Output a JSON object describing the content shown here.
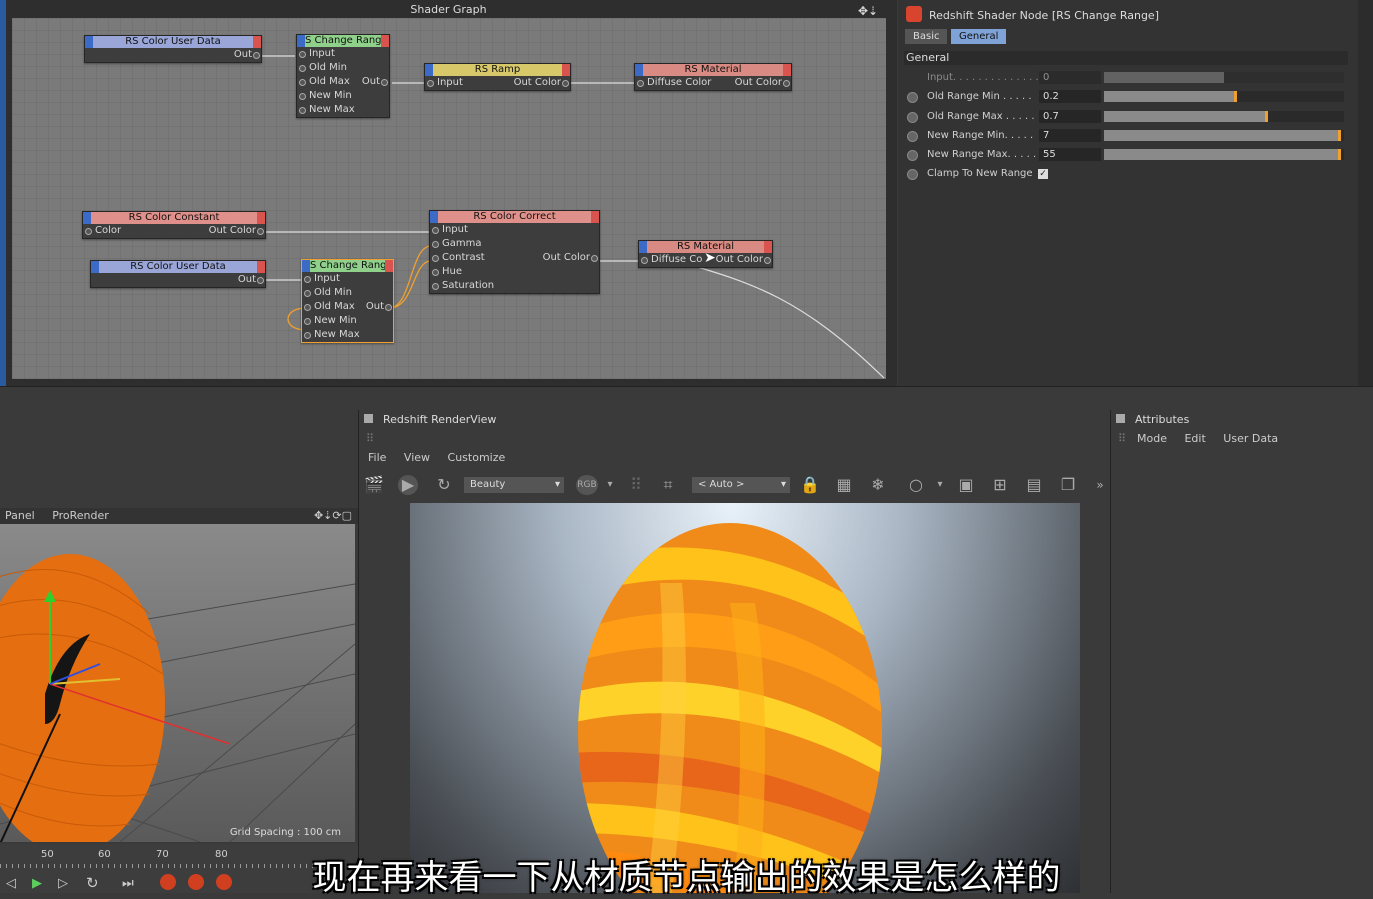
{
  "shader_graph": {
    "title": "Shader Graph",
    "nodes": {
      "user_data_1": {
        "title": "RS Color User Data",
        "out": "Out"
      },
      "change_range_1": {
        "title": "S Change Rang",
        "inputs": [
          "Input",
          "Old Min",
          "Old Max",
          "New Min",
          "New Max"
        ],
        "out": "Out"
      },
      "ramp": {
        "title": "RS Ramp",
        "input": "Input",
        "out": "Out Color"
      },
      "material_1": {
        "title": "RS Material",
        "input": "Diffuse Color",
        "out": "Out Color"
      },
      "color_constant": {
        "title": "RS Color Constant",
        "input": "Color",
        "out": "Out Color"
      },
      "color_correct": {
        "title": "RS Color Correct",
        "inputs": [
          "Input",
          "Gamma",
          "Contrast",
          "Hue",
          "Saturation"
        ],
        "out": "Out Color"
      },
      "material_2": {
        "title": "RS Material",
        "input": "Diffuse Co",
        "out": "Out Color"
      },
      "user_data_2": {
        "title": "RS Color User Data",
        "out": "Out"
      },
      "change_range_2": {
        "title": "S Change Rang",
        "inputs": [
          "Input",
          "Old Min",
          "Old Max",
          "New Min",
          "New Max"
        ],
        "out": "Out"
      }
    }
  },
  "attributes_top": {
    "title": "Redshift Shader Node [RS Change Range]",
    "tabs": [
      "Basic",
      "General"
    ],
    "active_tab": "General",
    "group": "General",
    "params": [
      {
        "label": "Input. . . . . . . . . . . . . . .",
        "value": "0",
        "fill": 0.5,
        "mark": null,
        "disabled": true
      },
      {
        "label": "Old Range Min . . . . .",
        "value": "0.2",
        "fill": 0.55,
        "mark": 0.55
      },
      {
        "label": "Old Range Max . . . . .",
        "value": "0.7",
        "fill": 0.68,
        "mark": 0.68
      },
      {
        "label": "New Range Min. . . . .",
        "value": "7",
        "fill": 0.985,
        "mark": 0.985
      },
      {
        "label": "New Range Max. . . . .",
        "value": "55",
        "fill": 0.985,
        "mark": 0.985
      }
    ],
    "clamp_label": "Clamp To New Range",
    "clamp_checked": true,
    "accent": "#f0a030"
  },
  "viewport": {
    "menu": [
      "Panel",
      "ProRender"
    ],
    "grid_spacing": "Grid Spacing : 100 cm",
    "timeline_ticks": [
      "50",
      "60",
      "70",
      "80"
    ]
  },
  "renderview": {
    "title": "Redshift RenderView",
    "menu": [
      "File",
      "View",
      "Customize"
    ],
    "aov": "Beauty",
    "zoom": "< Auto >"
  },
  "attributes_panel": {
    "title": "Attributes",
    "menu": [
      "Mode",
      "Edit",
      "User Data"
    ]
  },
  "subtitle": "现在再来看一下从材质节点输出的效果是怎么样的"
}
